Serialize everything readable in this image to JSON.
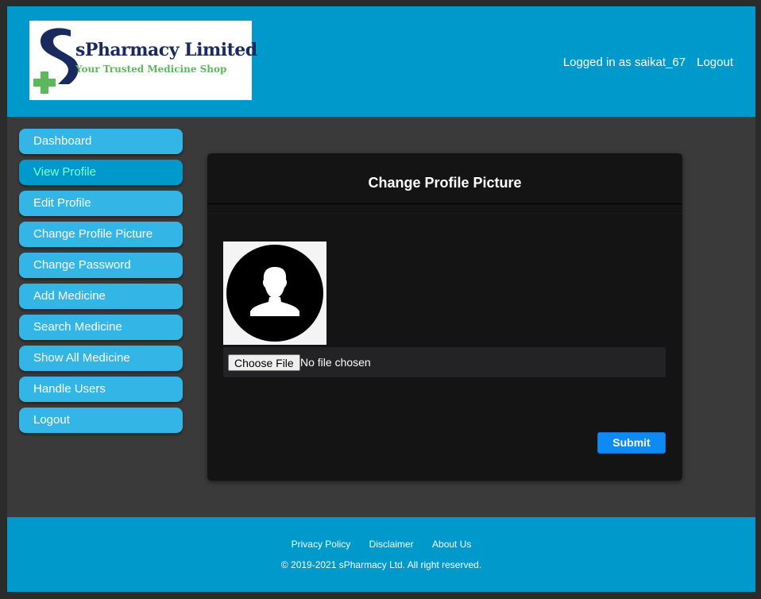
{
  "header": {
    "logo": {
      "title": "sPharmacy Limited",
      "tagline": "Your Trusted Medicine Shop",
      "colors": {
        "navy": "#1a2a5e",
        "green": "#5cb85c"
      }
    },
    "logged_in_text": "Logged in as saikat_67",
    "logout_label": "Logout"
  },
  "sidebar": {
    "items": [
      {
        "label": "Dashboard",
        "active": false
      },
      {
        "label": "View Profile",
        "active": true
      },
      {
        "label": "Edit Profile",
        "active": false
      },
      {
        "label": "Change Profile Picture",
        "active": false
      },
      {
        "label": "Change Password",
        "active": false
      },
      {
        "label": "Add Medicine",
        "active": false
      },
      {
        "label": "Search Medicine",
        "active": false
      },
      {
        "label": "Show All Medicine",
        "active": false
      },
      {
        "label": "Handle Users",
        "active": false
      },
      {
        "label": "Logout",
        "active": false
      }
    ]
  },
  "card": {
    "title": "Change Profile Picture",
    "avatar_icon": "user-silhouette-icon",
    "file_input": {
      "button_label": "Choose File",
      "status": "No file chosen"
    },
    "submit_label": "Submit"
  },
  "footer": {
    "links": [
      "Privacy Policy",
      "Disclaimer",
      "About Us"
    ],
    "copyright": "© 2019-2021 sPharmacy Ltd. All right reserved."
  },
  "colors": {
    "header_bg": "#0099cc",
    "nav_bg": "#33b5e5",
    "nav_active_text": "#7fffd4",
    "page_bg": "#3a3a3a",
    "card_bg": "#141414",
    "submit_bg": "#0d8bf2"
  }
}
